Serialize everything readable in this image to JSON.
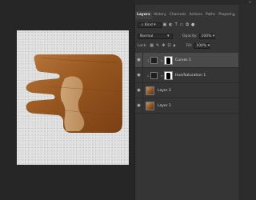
{
  "panel": {
    "tabs": [
      {
        "label": "Layers",
        "active": true
      },
      {
        "label": "History",
        "active": false
      },
      {
        "label": "Channels",
        "active": false
      },
      {
        "label": "Actions",
        "active": false
      },
      {
        "label": "Paths",
        "active": false
      },
      {
        "label": "Propert",
        "active": false
      }
    ],
    "menu_icon": "≡",
    "collapse_icon": "»"
  },
  "filter": {
    "kind_label": "Kind"
  },
  "blend": {
    "mode": "Normal",
    "opacity_label": "Opacity:",
    "opacity_value": "100%"
  },
  "lock": {
    "label": "Lock:",
    "fill_label": "Fill:",
    "fill_value": "100%"
  },
  "layers": [
    {
      "name": "Curves 1",
      "type": "adjustment",
      "selected": true
    },
    {
      "name": "Hue/Saturation 1",
      "type": "adjustment",
      "selected": false
    },
    {
      "name": "Layer 2",
      "type": "image",
      "selected": false
    },
    {
      "name": "Layer 1",
      "type": "image",
      "selected": false
    }
  ],
  "colors": {
    "panel_bg": "#353535",
    "selected_row": "#4a4a4a",
    "canvas_bg": "#262626"
  }
}
